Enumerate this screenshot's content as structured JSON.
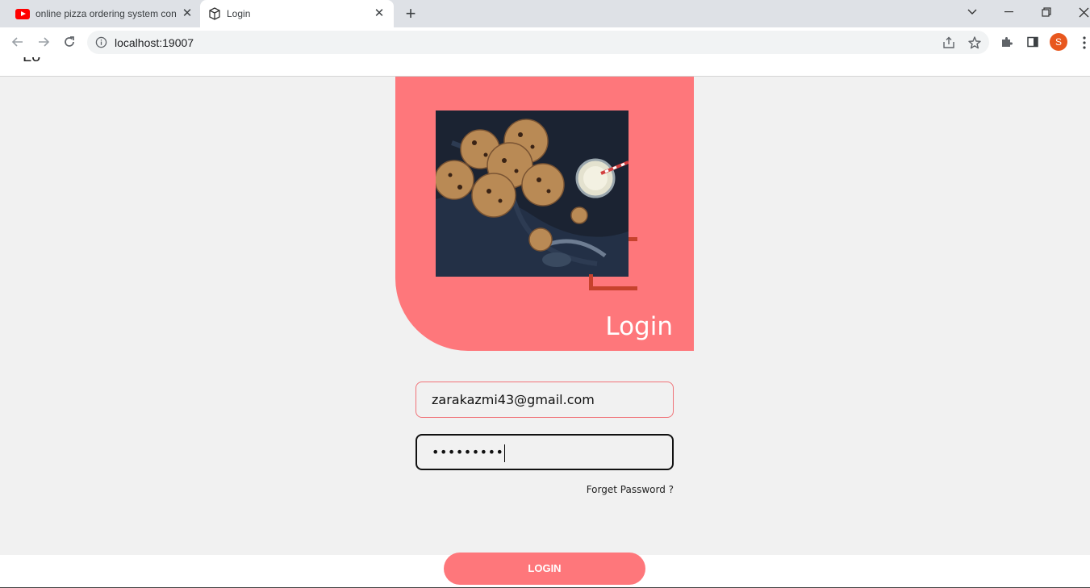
{
  "browser": {
    "tabs": [
      {
        "title": "online pizza ordering system con",
        "icon": "youtube-icon",
        "active": false
      },
      {
        "title": "Login",
        "icon": "cube-icon",
        "active": true
      }
    ],
    "address": "localhost:19007"
  },
  "page": {
    "header_text": "Lo",
    "hero_title": "Login",
    "hero_image": "cookies-and-milk-photo",
    "email_value": "zarakazmi43@gmail.com",
    "password_value": "•••••••••",
    "forget_password": "Forget Password ?",
    "login_button": "LOGIN"
  },
  "colors": {
    "accent": "#fe777b",
    "bracket": "#c7422d",
    "page_bg": "#f1f1f1"
  }
}
